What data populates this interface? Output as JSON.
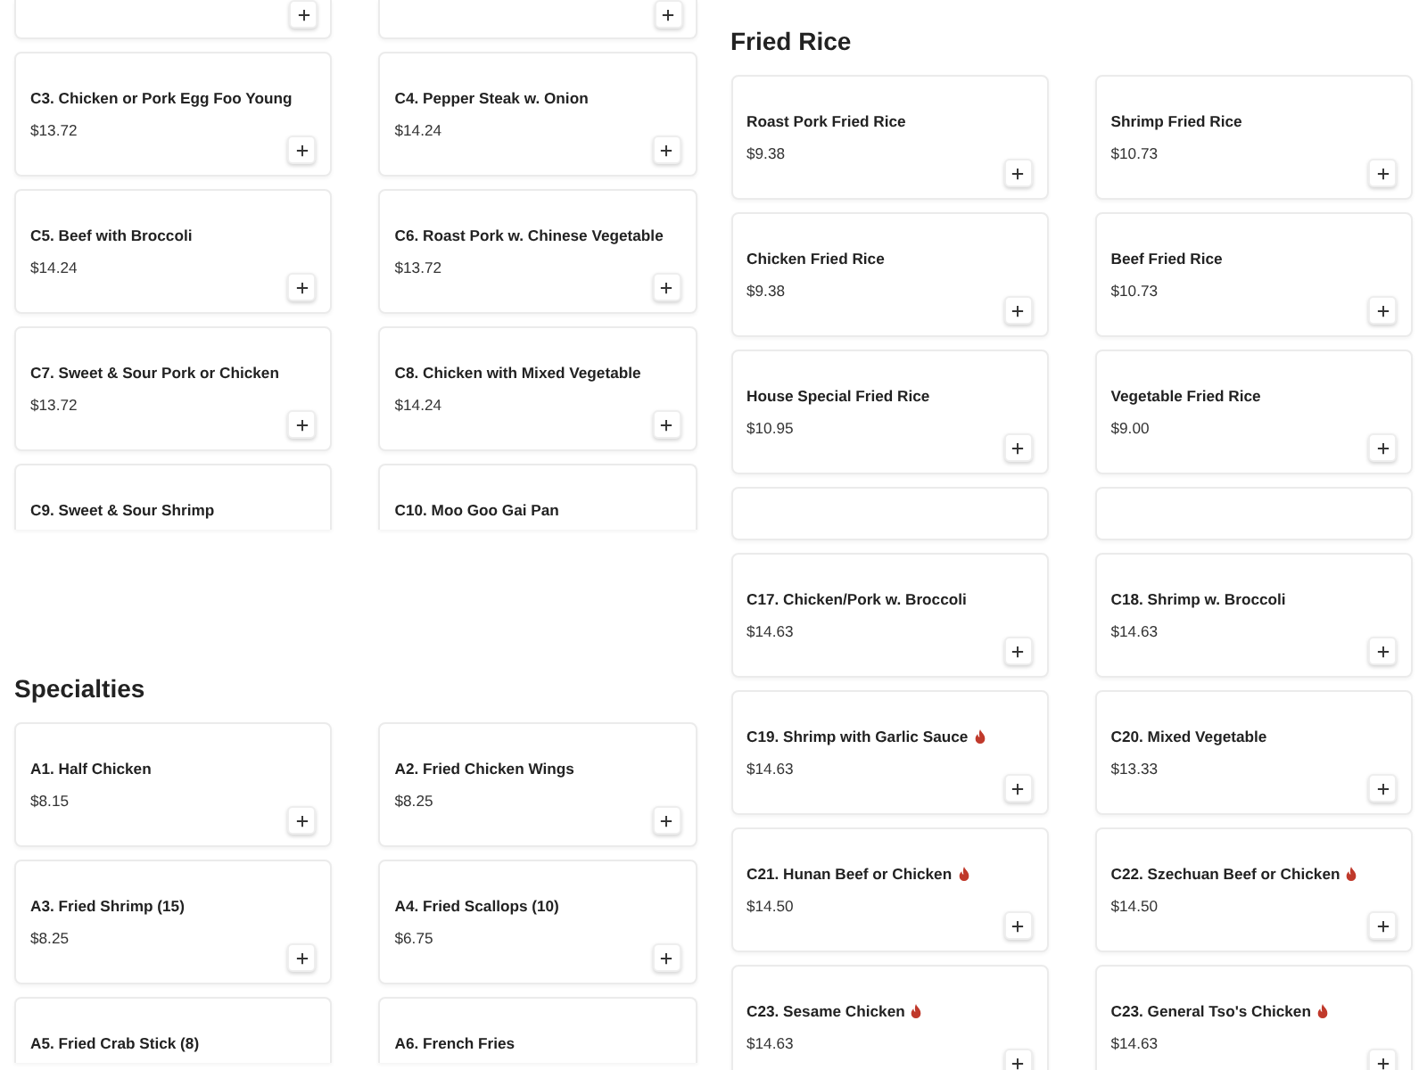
{
  "left_column": [
    {
      "items": [
        {
          "kind": "stub"
        },
        {
          "kind": "stub"
        },
        {
          "kind": "item",
          "name": "C3. Chicken or Pork Egg Foo Young",
          "price": "$13.72",
          "spicy": false
        },
        {
          "kind": "item",
          "name": "C4. Pepper Steak w. Onion",
          "price": "$14.24",
          "spicy": false
        },
        {
          "kind": "item",
          "name": "C5. Beef with Broccoli",
          "price": "$14.24",
          "spicy": false
        },
        {
          "kind": "item",
          "name": "C6. Roast Pork w. Chinese Vegetable",
          "price": "$13.72",
          "spicy": false
        },
        {
          "kind": "item",
          "name": "C7. Sweet & Sour Pork or Chicken",
          "price": "$13.72",
          "spicy": false
        },
        {
          "kind": "item",
          "name": "C8. Chicken with Mixed Vegetable",
          "price": "$14.24",
          "spicy": false
        },
        {
          "kind": "item",
          "name": "C9. Sweet & Sour Shrimp",
          "spicy": false
        },
        {
          "kind": "item",
          "name": "C10. Moo Goo Gai Pan",
          "spicy": false
        }
      ]
    },
    {
      "title": "Specialties",
      "items": [
        {
          "kind": "item",
          "name": "A1. Half Chicken",
          "price": "$8.15",
          "spicy": false
        },
        {
          "kind": "item",
          "name": "A2. Fried Chicken Wings",
          "price": "$8.25",
          "spicy": false
        },
        {
          "kind": "item",
          "name": "A3. Fried Shrimp (15)",
          "price": "$8.25",
          "spicy": false
        },
        {
          "kind": "item",
          "name": "A4. Fried Scallops (10)",
          "price": "$6.75",
          "spicy": false
        },
        {
          "kind": "item",
          "name": "A5. Fried Crab Stick (8)",
          "spicy": false
        },
        {
          "kind": "item",
          "name": "A6. French Fries",
          "spicy": false
        }
      ]
    }
  ],
  "right_column": [
    {
      "title": "Fried Rice",
      "items": [
        {
          "kind": "item",
          "name": "Roast Pork Fried Rice",
          "price": "$9.38",
          "spicy": false
        },
        {
          "kind": "item",
          "name": "Shrimp Fried Rice",
          "price": "$10.73",
          "spicy": false
        },
        {
          "kind": "item",
          "name": "Chicken Fried Rice",
          "price": "$9.38",
          "spicy": false
        },
        {
          "kind": "item",
          "name": "Beef Fried Rice",
          "price": "$10.73",
          "spicy": false
        },
        {
          "kind": "item",
          "name": "House Special Fried Rice",
          "price": "$10.95",
          "spicy": false
        },
        {
          "kind": "item",
          "name": "Vegetable Fried Rice",
          "price": "$9.00",
          "spicy": false
        },
        {
          "kind": "blank"
        },
        {
          "kind": "blank"
        }
      ]
    },
    {
      "items": [
        {
          "kind": "item",
          "name": "C17. Chicken/Pork w. Broccoli",
          "price": "$14.63",
          "spicy": false
        },
        {
          "kind": "item",
          "name": "C18. Shrimp w. Broccoli",
          "price": "$14.63",
          "spicy": false
        },
        {
          "kind": "item",
          "name": "C19. Shrimp with Garlic Sauce",
          "price": "$14.63",
          "spicy": true
        },
        {
          "kind": "item",
          "name": "C20. Mixed Vegetable",
          "price": "$13.33",
          "spicy": false
        },
        {
          "kind": "item",
          "name": "C21. Hunan Beef or Chicken",
          "price": "$14.50",
          "spicy": true
        },
        {
          "kind": "item",
          "name": "C22. Szechuan Beef or Chicken",
          "price": "$14.50",
          "spicy": true
        },
        {
          "kind": "item",
          "name": "C23. Sesame Chicken",
          "price": "$14.63",
          "spicy": true
        },
        {
          "kind": "item",
          "name": "C23. General Tso's Chicken",
          "price": "$14.63",
          "spicy": true
        }
      ]
    }
  ]
}
